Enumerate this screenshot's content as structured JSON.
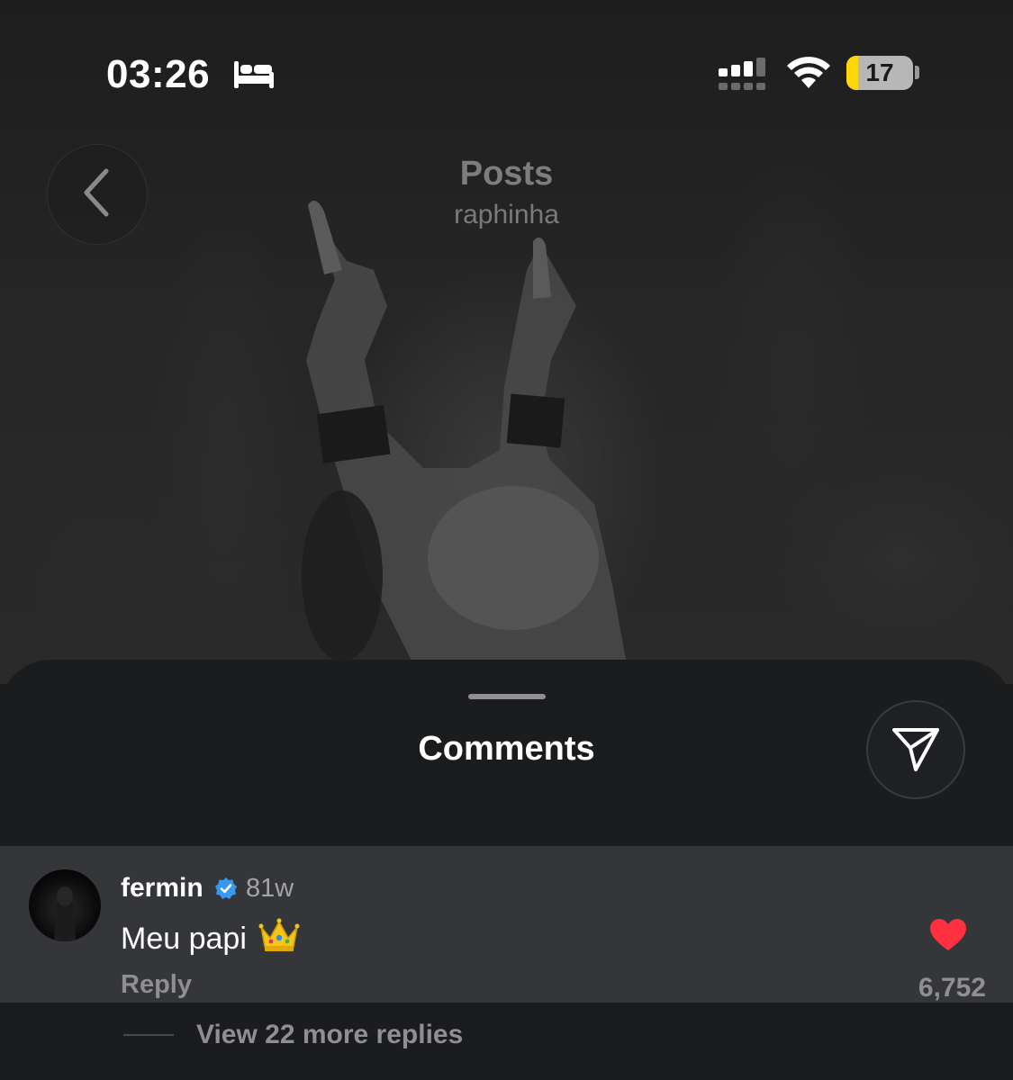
{
  "status_bar": {
    "time": "03:26",
    "battery_level": "17",
    "battery_fraction": 0.17,
    "icons": [
      "bed-icon",
      "cellular-signal-icon",
      "wifi-icon",
      "battery-icon"
    ]
  },
  "header": {
    "back_icon": "chevron-left-icon",
    "title": "Posts",
    "subtitle": "raphinha"
  },
  "comments_sheet": {
    "title": "Comments",
    "share_icon": "send-paper-plane-icon",
    "comment": {
      "username": "fermin",
      "verified": true,
      "verified_color": "#3897f0",
      "time_ago": "81w",
      "text": "Meu papi",
      "emoji_icon": "crown-icon",
      "reply_label": "Reply",
      "liked": true,
      "heart_color": "#ff3040",
      "like_count": "6,752"
    },
    "view_replies_label": "View 22 more replies"
  }
}
